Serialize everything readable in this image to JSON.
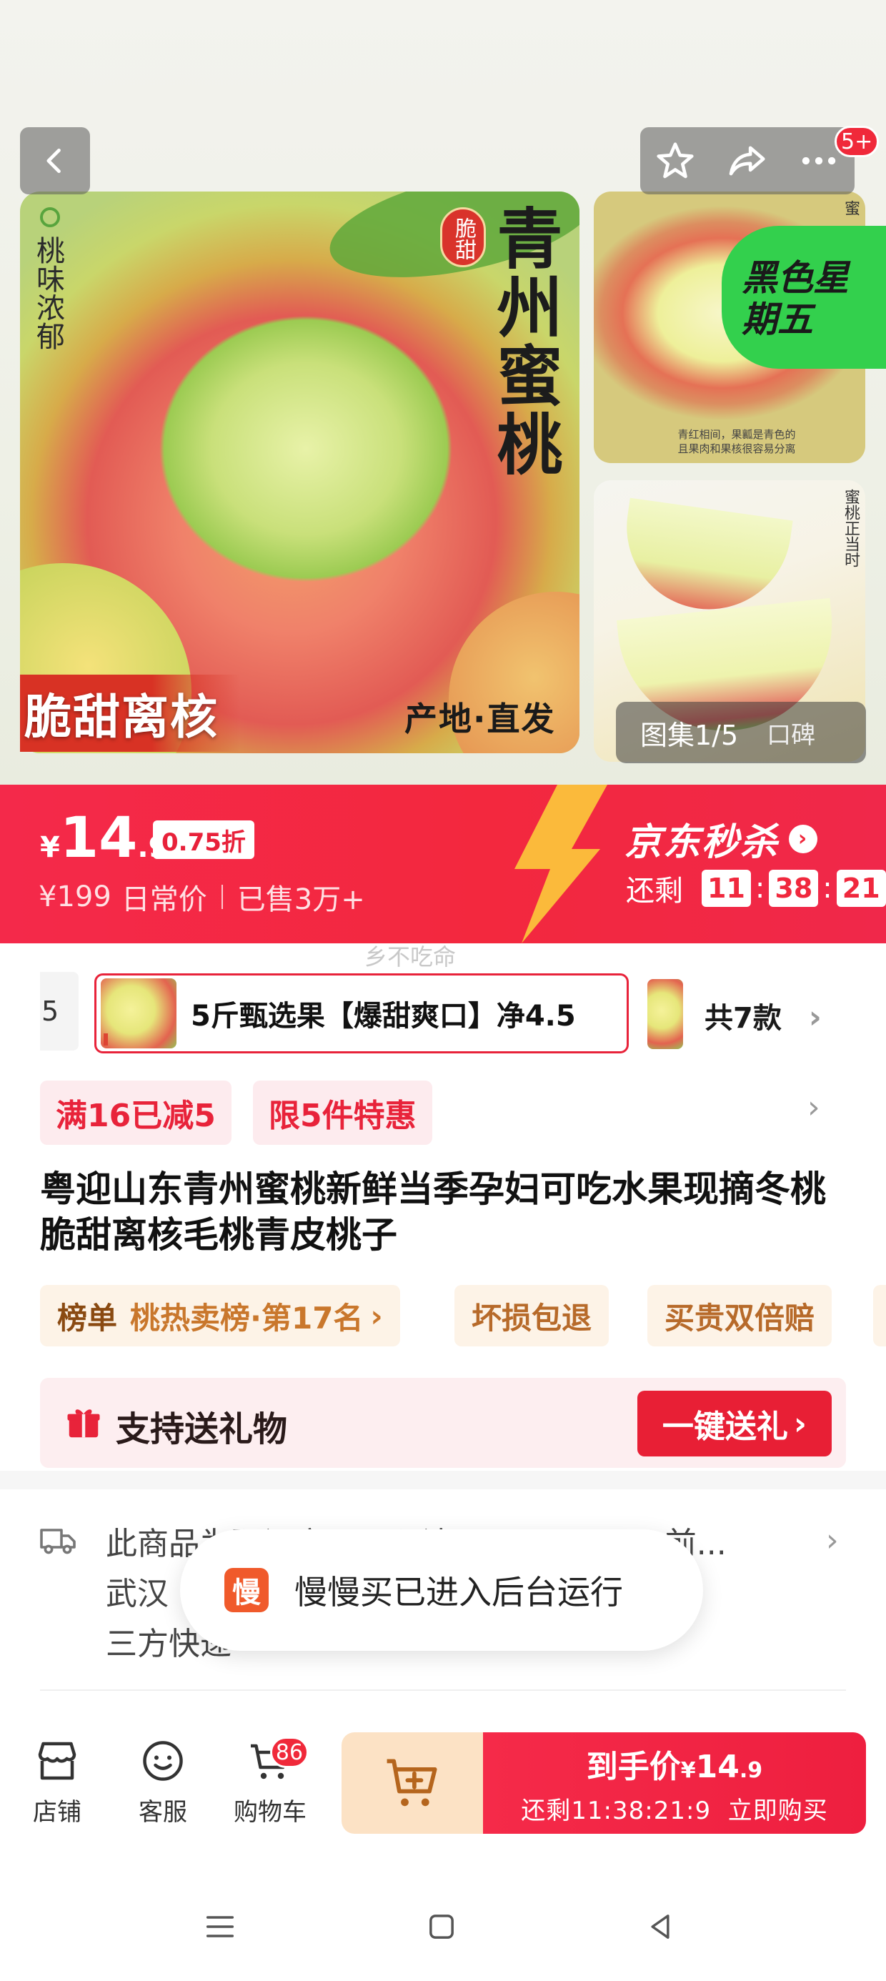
{
  "gallery": {
    "counter": "图集1/5",
    "counter_extra": "口碑",
    "notification_badge": "5+",
    "main_image": {
      "title": "青州蜜桃",
      "badge": "脆甜",
      "side_text": "桃味浓郁",
      "bottom_left": "脆甜离核",
      "bottom_right": "产地·直发"
    },
    "side_image_1_caption": "青红相间，果瓤是青色的\n且果肉和果核很容易分离",
    "side_image_1_vertical": "蜜",
    "side_image_2_vertical": "蜜桃正当时",
    "promo_sticker": "黑色星期五"
  },
  "price": {
    "currency": "¥",
    "integer": "14",
    "decimal": ".9",
    "discount": "0.75折",
    "original": "¥199",
    "original_label": "日常价",
    "sold": "已售3万+",
    "flash_sale": "京东秒杀",
    "remaining_label": "还剩",
    "countdown": [
      "11",
      "38",
      "21"
    ]
  },
  "watermark": "乡不吃命",
  "variants": {
    "previous_fragment": "5",
    "selected": "5斤甄选果【爆甜爽口】净4.5",
    "total": "共7款"
  },
  "promotions": [
    "满16已减5",
    "限5件特惠"
  ],
  "product_title": "粤迎山东青州蜜桃新鲜当季孕妇可吃水果现摘冬桃脆甜离核毛桃青皮桃子",
  "service_tags": {
    "rank_label": "榜单",
    "rank_text": "桃热卖榜·第17名",
    "tags": [
      "坏损包退",
      "买贵双倍赔"
    ]
  },
  "gift": {
    "label": "支持送礼物",
    "button": "一键送礼"
  },
  "shipping": {
    "line1": "此商品为预订商品，预计9月20日24:00前...",
    "line2": "武汉",
    "line3": "三方快递"
  },
  "toast": {
    "icon": "慢",
    "text": "慢慢买已进入后台运行"
  },
  "bottom_bar": {
    "store": "店铺",
    "service": "客服",
    "cart": "购物车",
    "cart_count": "86",
    "buy_label": "到手价",
    "buy_currency": "¥",
    "buy_price_int": "14",
    "buy_price_dec": ".9",
    "buy_sub": "还剩11:38:21:9  立即购买"
  }
}
